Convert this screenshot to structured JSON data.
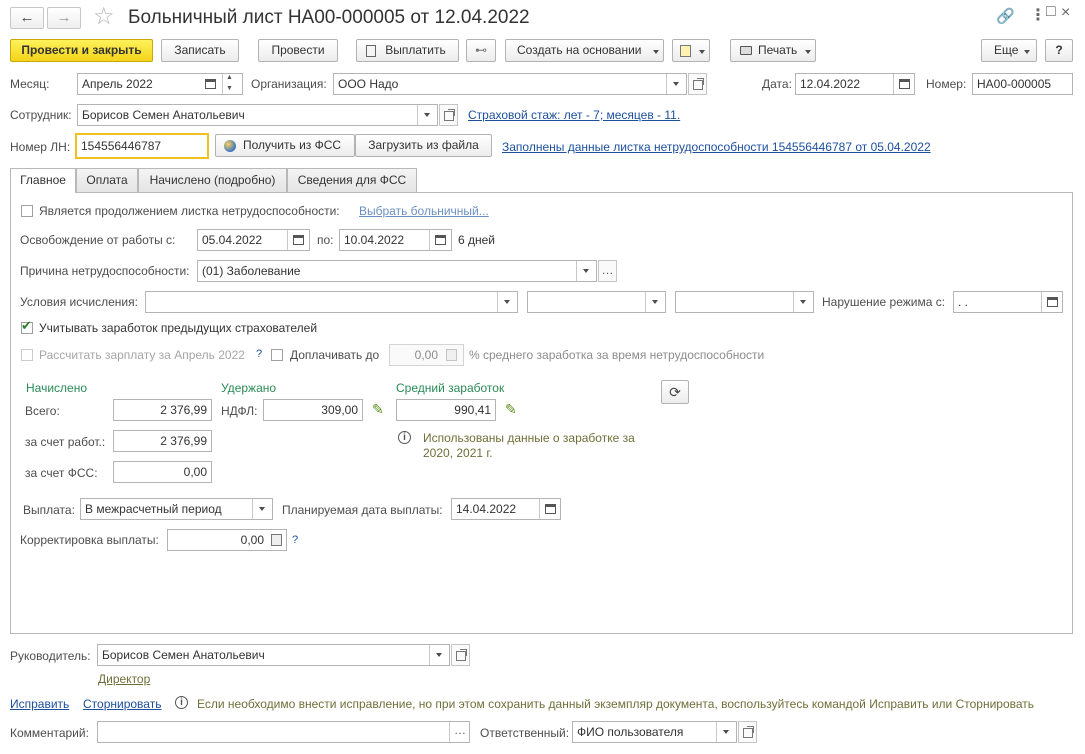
{
  "window": {
    "title": "Больничный лист НА00-000005 от 12.04.2022"
  },
  "toolbar": {
    "post_close": "Провести и закрыть",
    "write": "Записать",
    "post": "Провести",
    "pay": "Выплатить",
    "create_based": "Создать на основании",
    "print": "Печать",
    "more": "Еще",
    "help": "?"
  },
  "header": {
    "month_label": "Месяц:",
    "month_value": "Апрель 2022",
    "org_label": "Организация:",
    "org_value": "ООО Надо",
    "date_label": "Дата:",
    "date_value": "12.04.2022",
    "number_label": "Номер:",
    "number_value": "НА00-000005",
    "employee_label": "Сотрудник:",
    "employee_value": "Борисов Семен Анатольевич",
    "insurance_link": "Страховой стаж: лет - 7; месяцев - 11.",
    "ln_label": "Номер ЛН:",
    "ln_value": "154556446787",
    "get_fss": "Получить из ФСС",
    "load_file": "Загрузить из файла",
    "filled_link": "Заполнены данные листка нетрудоспособности 154556446787 от 05.04.2022"
  },
  "tabs": [
    "Главное",
    "Оплата",
    "Начислено (подробно)",
    "Сведения для ФСС"
  ],
  "main": {
    "continuation_label": "Является продолжением листка нетрудоспособности:",
    "choose_sick_link": "Выбрать больничный...",
    "release_label": "Освобождение от работы с:",
    "release_from": "05.04.2022",
    "release_to_label": "по:",
    "release_to": "10.04.2022",
    "days": "6 дней",
    "cause_label": "Причина нетрудоспособности:",
    "cause_value": "(01) Заболевание",
    "conditions_label": "Условия исчисления:",
    "violation_label": "Нарушение режима с:",
    "violation_value": " .  .",
    "consider_prev_label": "Учитывать заработок предыдущих страхователей",
    "calc_salary_label": "Рассчитать зарплату за Апрель 2022",
    "question": "?",
    "add_pay_label": "Доплачивать до",
    "add_pay_value": "0,00",
    "add_pay_suffix": "% среднего заработка за время нетрудоспособности",
    "accrued_title": "Начислено",
    "withheld_title": "Удержано",
    "avg_title": "Средний заработок",
    "total_label": "Всего:",
    "total_value": "2 376,99",
    "employer_label": "за счет работ.:",
    "employer_value": "2 376,99",
    "fss_label": "за счет ФСС:",
    "fss_value": "0,00",
    "ndfl_label": "НДФЛ:",
    "ndfl_value": "309,00",
    "avg_value": "990,41",
    "avg_note_line1": "Использованы данные о заработке за",
    "avg_note_line2": "2020,  2021 г.",
    "payout_label": "Выплата:",
    "payout_value": "В межрасчетный период",
    "planned_date_label": "Планируемая дата выплаты:",
    "planned_date_value": "14.04.2022",
    "correction_label": "Корректировка выплаты:",
    "correction_value": "0,00"
  },
  "footer": {
    "head_label": "Руководитель:",
    "head_value": "Борисов Семен Анатольевич",
    "head_position": "Директор",
    "fix_link": "Исправить",
    "storno_link": "Сторнировать",
    "fix_note": "Если необходимо внести исправление, но при этом сохранить данный экземпляр документа, воспользуйтесь командой Исправить или Сторнировать",
    "comment_label": "Комментарий:",
    "comment_value": "",
    "responsible_label": "Ответственный:",
    "responsible_value": "ФИО пользователя"
  },
  "colors": {
    "primary_button": "#f4d31a",
    "link": "#1c4f9c",
    "section_title": "#2a8a56",
    "focus": "#f0c020"
  }
}
